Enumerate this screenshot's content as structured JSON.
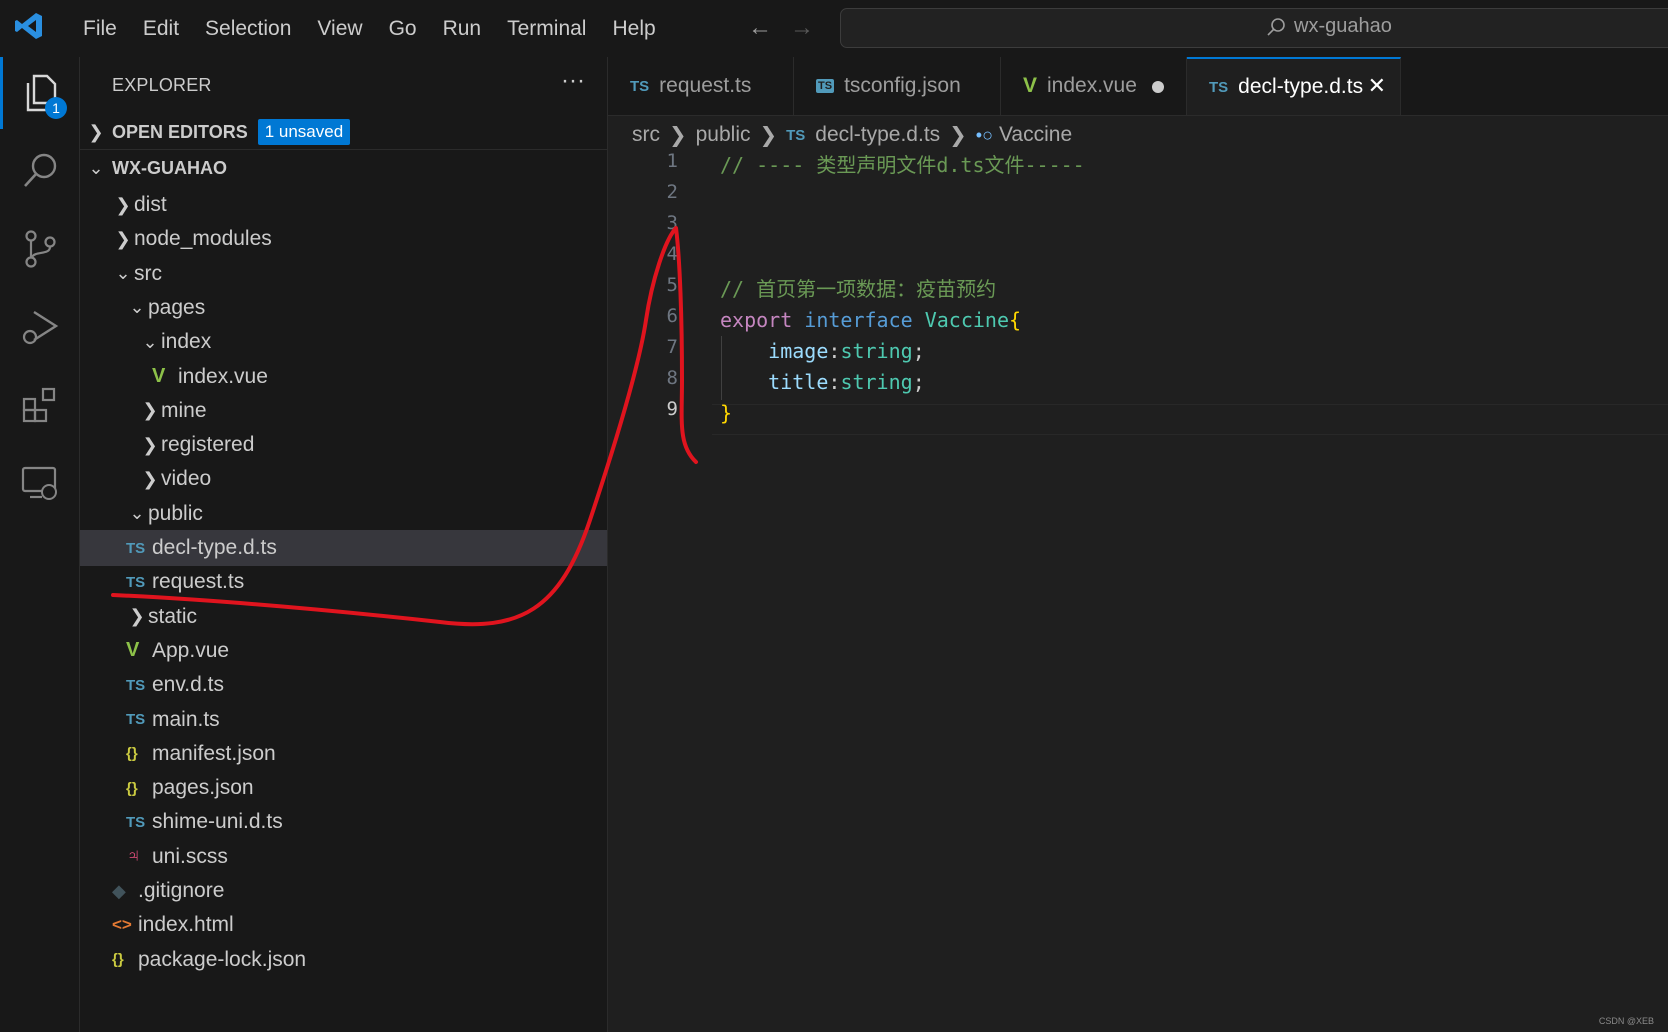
{
  "menu": [
    "File",
    "Edit",
    "Selection",
    "View",
    "Go",
    "Run",
    "Terminal",
    "Help"
  ],
  "search": {
    "text": "wx-guahao"
  },
  "activity": {
    "badge": "1"
  },
  "explorer": {
    "title": "EXPLORER",
    "open_editors": {
      "label": "OPEN EDITORS",
      "badge": "1 unsaved"
    },
    "workspace": "WX-GUAHAO",
    "tree": [
      {
        "name": "dist",
        "icon": "chevron-right"
      },
      {
        "name": "node_modules",
        "icon": "chevron-right"
      },
      {
        "name": "src",
        "icon": "chevron-down"
      },
      {
        "name": "pages",
        "icon": "chevron-down"
      },
      {
        "name": "index",
        "icon": "chevron-down"
      },
      {
        "name": "index.vue",
        "icon": "vue"
      },
      {
        "name": "mine",
        "icon": "chevron-right"
      },
      {
        "name": "registered",
        "icon": "chevron-right"
      },
      {
        "name": "video",
        "icon": "chevron-right"
      },
      {
        "name": "public",
        "icon": "chevron-down"
      },
      {
        "name": "decl-type.d.ts",
        "icon": "ts",
        "selected": true
      },
      {
        "name": "request.ts",
        "icon": "ts"
      },
      {
        "name": "static",
        "icon": "chevron-right"
      },
      {
        "name": "App.vue",
        "icon": "vue"
      },
      {
        "name": "env.d.ts",
        "icon": "ts"
      },
      {
        "name": "main.ts",
        "icon": "ts"
      },
      {
        "name": "manifest.json",
        "icon": "json"
      },
      {
        "name": "pages.json",
        "icon": "json"
      },
      {
        "name": "shime-uni.d.ts",
        "icon": "ts"
      },
      {
        "name": "uni.scss",
        "icon": "scss"
      },
      {
        "name": ".gitignore",
        "icon": "git"
      },
      {
        "name": "index.html",
        "icon": "html"
      },
      {
        "name": "package-lock.json",
        "icon": "json"
      }
    ]
  },
  "tabs": [
    {
      "label": "request.ts",
      "icon": "TS"
    },
    {
      "label": "tsconfig.json",
      "icon": "TS"
    },
    {
      "label": "index.vue",
      "icon": "V",
      "dirty": true
    },
    {
      "label": "decl-type.d.ts",
      "icon": "TS",
      "active": true
    }
  ],
  "breadcrumb": {
    "seg1": "src",
    "seg2": "public",
    "file": "decl-type.d.ts",
    "symbol": "Vaccine",
    "ts_icon": "TS"
  },
  "editor": {
    "line_numbers": [
      "1",
      "2",
      "3",
      "4",
      "5",
      "6",
      "7",
      "8",
      "9"
    ],
    "line1": "// ---- 类型声明文件d.ts文件-----",
    "line5": "// 首页第一项数据：疫苗预约",
    "line6_kw": "export",
    "line6_kw2": "interface",
    "line6_name": "Vaccine",
    "line6_brace": "{",
    "line7_prop": "image",
    "line7_type": "string",
    "line8_prop": "title",
    "line8_type": "string",
    "line9_brace": "}",
    "colon": ":",
    "semi": ";"
  },
  "watermark": "CSDN @XEB",
  "colors": {
    "accent": "#0078d4",
    "annotation": "#e0141e"
  }
}
